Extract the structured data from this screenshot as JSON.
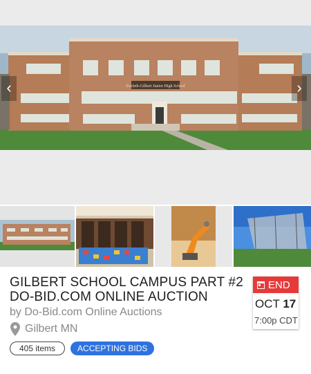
{
  "carousel": {
    "prev_icon": "chevron-left-icon",
    "next_icon": "chevron-right-icon",
    "sign_text": "Eveleth-Gilbert Junior High School"
  },
  "thumbnails": [
    {
      "name": "school-exterior"
    },
    {
      "name": "library-room"
    },
    {
      "name": "robot-arm"
    },
    {
      "name": "batting-cage"
    }
  ],
  "auction": {
    "title_line1": "GILBERT SCHOOL CAMPUS PART #2",
    "title_line2": "DO-BID.COM ONLINE AUCTION",
    "seller": "by Do-Bid.com Online Auctions",
    "location": "Gilbert MN",
    "items_count": "405 items",
    "status": "ACCEPTING BIDS"
  },
  "end": {
    "label": "END",
    "month": "OCT",
    "day": "17",
    "time": "7:00p CDT"
  },
  "colors": {
    "status_blue": "#2e72e0",
    "end_red": "#e63a3a"
  }
}
